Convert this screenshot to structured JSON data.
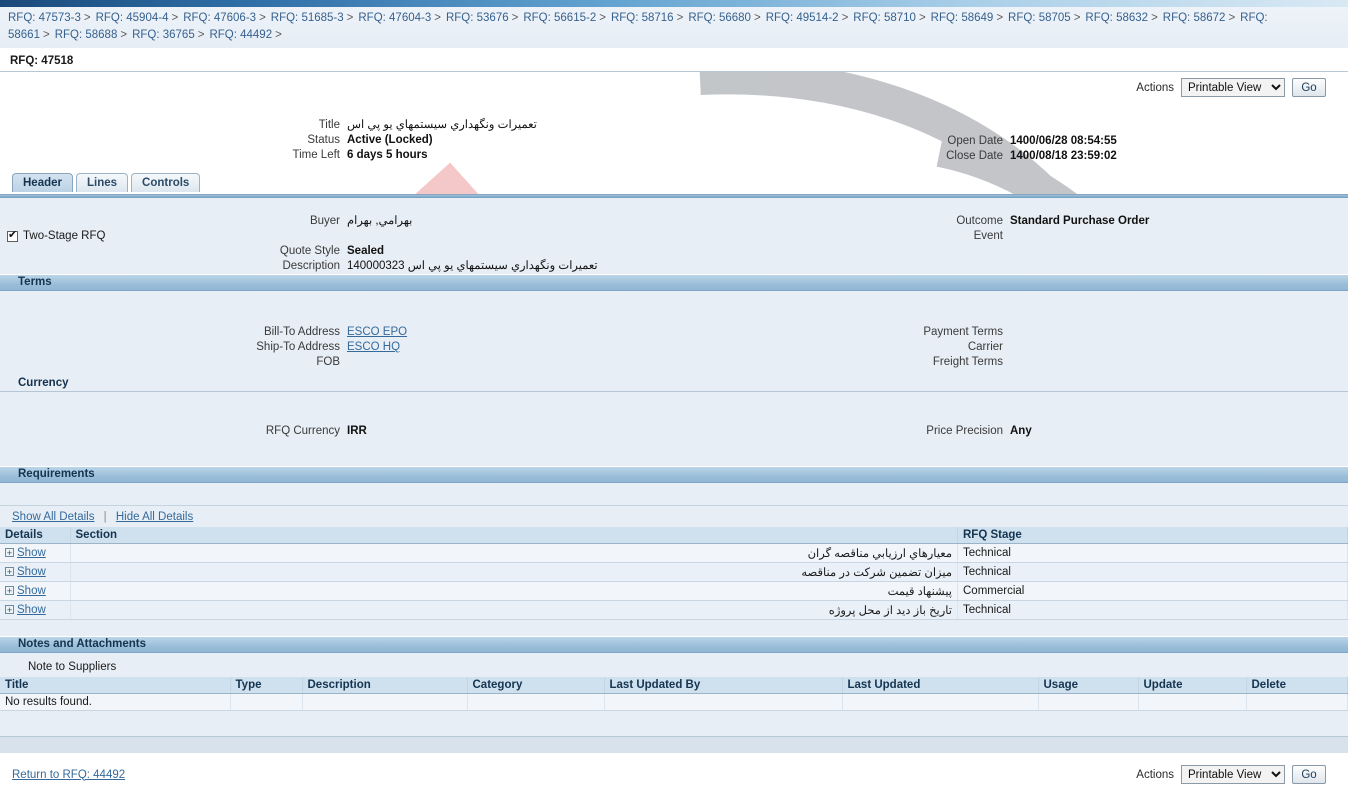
{
  "breadcrumb": {
    "name": "breadcrumb-trail",
    "items": [
      "RFQ: 47573-3",
      "RFQ: 45904-4",
      "RFQ: 47606-3",
      "RFQ: 51685-3",
      "RFQ: 47604-3",
      "RFQ: 53676",
      "RFQ: 56615-2",
      "RFQ: 58716",
      "RFQ: 56680",
      "RFQ: 49514-2",
      "RFQ: 58710",
      "RFQ: 58649",
      "RFQ: 58705",
      "RFQ: 58632",
      "RFQ: 58672",
      "RFQ: 58661",
      "RFQ: 58688",
      "RFQ: 36765",
      "RFQ: 44492"
    ],
    "separator": ">",
    "current": "RFQ: 47518"
  },
  "actions": {
    "label": "Actions",
    "selected": "Printable View",
    "options": [
      "Printable View"
    ],
    "go_label": "Go"
  },
  "summary": {
    "title_label": "Title",
    "title_value": "تعميرات ونگهداري سيستمهاي يو پي اس",
    "status_label": "Status",
    "status_value": "Active (Locked)",
    "time_left_label": "Time Left",
    "time_left_value": "6 days 5 hours",
    "open_date_label": "Open Date",
    "open_date_value": "1400/06/28 08:54:55",
    "close_date_label": "Close Date",
    "close_date_value": "1400/08/18 23:59:02"
  },
  "tabs": [
    {
      "label": "Header",
      "active": true
    },
    {
      "label": "Lines",
      "active": false
    },
    {
      "label": "Controls",
      "active": false
    }
  ],
  "header_section": {
    "buyer_label": "Buyer",
    "buyer_value": "بهرامي, بهرام",
    "two_stage_label": "Two-Stage RFQ",
    "two_stage_checked": true,
    "quote_style_label": "Quote Style",
    "quote_style_value": "Sealed",
    "description_label": "Description",
    "description_value": "تعميرات ونگهداري سيستمهاي يو پي اس  140000323",
    "outcome_label": "Outcome",
    "outcome_value": "Standard Purchase Order",
    "event_label": "Event",
    "event_value": ""
  },
  "terms": {
    "band_title": "Terms",
    "bill_to_label": "Bill-To Address",
    "bill_to_value": "ESCO EPO",
    "ship_to_label": "Ship-To Address",
    "ship_to_value": "ESCO HQ",
    "fob_label": "FOB",
    "fob_value": "",
    "payment_terms_label": "Payment Terms",
    "payment_terms_value": "",
    "carrier_label": "Carrier",
    "carrier_value": "",
    "freight_terms_label": "Freight Terms",
    "freight_terms_value": ""
  },
  "currency": {
    "sub_title": "Currency",
    "rfq_currency_label": "RFQ Currency",
    "rfq_currency_value": "IRR",
    "price_precision_label": "Price Precision",
    "price_precision_value": "Any"
  },
  "requirements": {
    "band_title": "Requirements",
    "show_all_label": "Show All Details",
    "hide_all_label": "Hide All Details",
    "columns": [
      "Details",
      "Section",
      "RFQ Stage"
    ],
    "rows": [
      {
        "details": "Show",
        "section": "معيارهاي ارزيابي مناقصه گران",
        "stage": "Technical"
      },
      {
        "details": "Show",
        "section": "ميزان تضمين شركت در مناقصه",
        "stage": "Technical"
      },
      {
        "details": "Show",
        "section": "پيشنهاد قيمت",
        "stage": "Commercial"
      },
      {
        "details": "Show",
        "section": "تاريخ باز ديد از محل پروژه",
        "stage": "Technical"
      }
    ]
  },
  "notes": {
    "band_title": "Notes and Attachments",
    "note_to_suppliers_label": "Note to Suppliers",
    "note_to_suppliers_value": "",
    "columns": [
      "Title",
      "Type",
      "Description",
      "Category",
      "Last Updated By",
      "Last Updated",
      "Usage",
      "Update",
      "Delete"
    ],
    "empty_message": "No results found."
  },
  "footer": {
    "return_link": "Return to RFQ: 44492",
    "actions_label": "Actions",
    "selected": "Printable View",
    "go_label": "Go"
  },
  "colors": {
    "band": "#9dc0da",
    "panel": "#e8eef5",
    "link": "#356a9b",
    "watermark_gray": "#b9bcc0",
    "watermark_pink": "#f0b5b5"
  }
}
